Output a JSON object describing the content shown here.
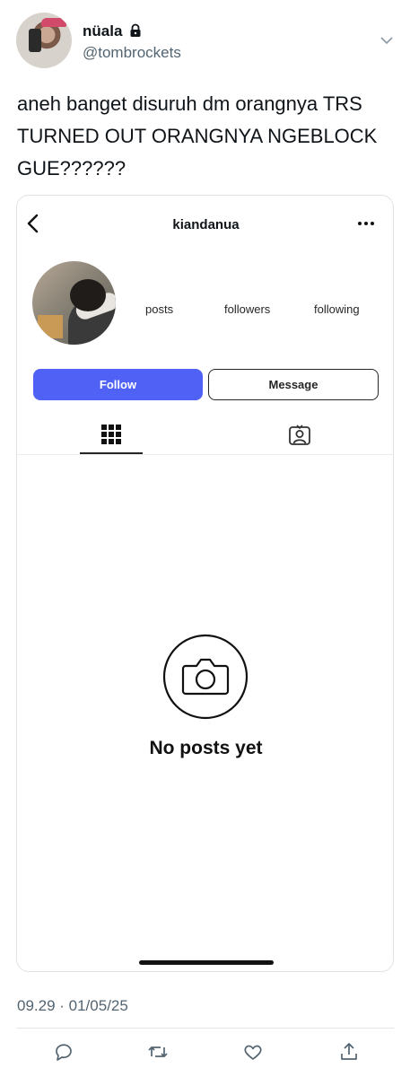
{
  "tweet": {
    "display_name": "nüala",
    "handle": "@tombrockets",
    "text": "aneh banget disuruh dm orangnya TRS TURNED OUT ORANGNYA NGEBLOCK GUE??????",
    "timestamp": "09.29 · 01/05/25"
  },
  "instagram": {
    "username": "kiandanua",
    "stats": {
      "posts_label": "posts",
      "followers_label": "followers",
      "following_label": "following"
    },
    "follow_label": "Follow",
    "message_label": "Message",
    "empty_title": "No posts yet",
    "accent_color": "#4f62f5"
  },
  "icons": [
    "lock-icon",
    "chevron-down-icon",
    "back-arrow-icon",
    "more-dots-icon",
    "grid-icon",
    "tagged-icon",
    "camera-icon",
    "reply-icon",
    "retweet-icon",
    "like-icon",
    "share-icon"
  ]
}
